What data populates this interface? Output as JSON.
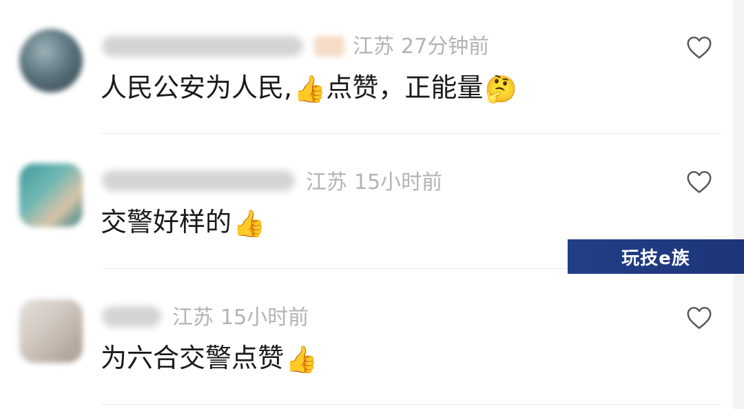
{
  "comments": [
    {
      "location": "江苏",
      "time": "27分钟前",
      "text": "人民公安为人民,",
      "emoji_thumb": "👍",
      "text2": "点赞，正能量",
      "emoji_end": "🤔"
    },
    {
      "location": "江苏",
      "time": "15小时前",
      "text": "交警好样的",
      "emoji_thumb": "👍"
    },
    {
      "location": "江苏",
      "time": "15小时前",
      "text": "为六合交警点赞",
      "emoji_thumb": "👍"
    }
  ],
  "watermark": {
    "text": "玩技e族"
  },
  "icons": {
    "like": "heart-outline-icon"
  }
}
